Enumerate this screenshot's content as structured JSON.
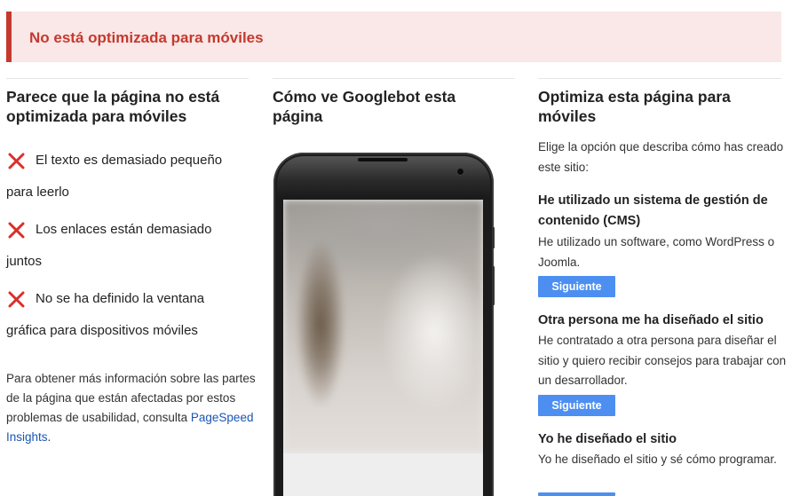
{
  "banner": {
    "text": "No está optimizada para móviles"
  },
  "left": {
    "heading": "Parece que la página no está optimizada para móviles",
    "issues": [
      {
        "line1": "El texto es demasiado pequeño",
        "line2": "para leerlo"
      },
      {
        "line1": "Los enlaces están demasiado",
        "line2": "juntos"
      },
      {
        "line1": "No se ha definido la ventana",
        "line2": "gráfica para dispositivos móviles"
      }
    ],
    "more_info_text": "Para obtener más información sobre las partes de la página que están afectadas por estos problemas de usabilidad, consulta ",
    "more_info_link": "PageSpeed Insights",
    "more_info_end": "."
  },
  "middle": {
    "heading": "Cómo ve Googlebot esta página"
  },
  "right": {
    "heading": "Optimiza esta página para móviles",
    "intro": "Elige la opción que describa cómo has creado este sitio:",
    "options": [
      {
        "title": "He utilizado un sistema de gestión de contenido (CMS)",
        "desc": "He utilizado un software, como WordPress o Joomla.",
        "button": "Siguiente"
      },
      {
        "title": "Otra persona me ha diseñado el sitio",
        "desc": "He contratado a otra persona para diseñar el sitio y quiero recibir consejos para trabajar con un desarrollador.",
        "button": "Siguiente"
      },
      {
        "title": "Yo he diseñado el sitio",
        "desc": "Yo he diseñado el sitio y sé cómo programar."
      }
    ]
  },
  "colors": {
    "error": "#c5392f",
    "banner_bg": "#f9e8e7",
    "button": "#4d8ff0",
    "link": "#1a55b3"
  },
  "icons": {
    "issue": "x-icon"
  }
}
